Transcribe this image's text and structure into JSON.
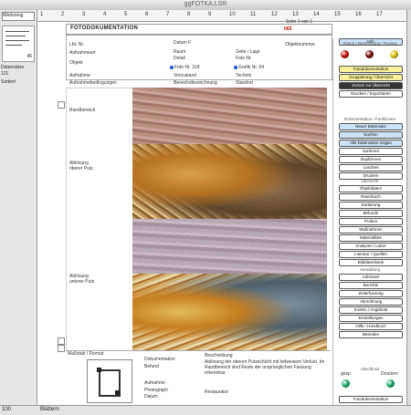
{
  "window": {
    "title": "ggFOTKA.LSR"
  },
  "ruler": {
    "ticks": [
      "1",
      "2",
      "3",
      "4",
      "5",
      "6",
      "7",
      "8",
      "9",
      "10",
      "11",
      "12",
      "13",
      "14",
      "15",
      "16",
      "17"
    ]
  },
  "left_panel": {
    "layout_select": "Werkzeug",
    "zoom_badge": "46",
    "records_label": "Datensätze",
    "records_value": "121",
    "sort_label": "Sortiert"
  },
  "header": {
    "title": "FOTODOKUMENTATION",
    "top_right": "Seite 1 von 1",
    "number": "003"
  },
  "fields": {
    "lfd_nr": "Lfd. Nr.",
    "datum": "Datum F",
    "objektnummer": "Objektnummer",
    "aufnahmeart": "Aufnahmeart",
    "raum": "Raum",
    "seite": "Seite / Lage",
    "detail": "Detail",
    "foto_nr": "Foto Nr.",
    "objekt": "Objekt",
    "radio1": "Foto Nr. 318",
    "radio2": "Grafik Nr. 04",
    "bild1": "Aufnahme",
    "bild2": "Vorzustand",
    "bild3": "Technik",
    "hint1": "Aufnahmebedingungen",
    "hint2": "Bereichsbezeichnung",
    "hint3": "Standort"
  },
  "captions": {
    "c1": "Randbereich",
    "c2": "Ablösung\noberer Putz",
    "c3": "Ablösung\nunterer Putz"
  },
  "footer": {
    "tools": "Maßstab / Format",
    "col1": "Dokumentation",
    "col2": "Befund",
    "col3": "Beschreibung",
    "text": "Ablösung der oberen Putzschicht mit teilweisem Verlust. Im Randbereich sind Reste der ursprünglichen Fassung erkennbar.",
    "note1": "Aufnahme",
    "note2": "Photograph",
    "note3": "Datum",
    "note4": "Restaurator"
  },
  "right_panel": {
    "tab": "Info",
    "signal_label": "Status / Bearbeitung / Review",
    "signals": [
      "#c40000",
      "#7a0000",
      "#d9c100"
    ],
    "buttons_top": [
      {
        "label": "Fotodokumentation",
        "style": "yel"
      },
      {
        "label": "Gruppierung / Übersicht",
        "style": "yel"
      },
      {
        "label": "Zurück zur Übersicht",
        "style": "dark"
      },
      {
        "label": "Drucken / Exportieren",
        "style": ""
      }
    ],
    "sec1": "Dokumentation / Funktionen",
    "buttons_mid": [
      {
        "label": "Neuer Datensatz",
        "style": "blu"
      },
      {
        "label": "Suchen",
        "style": "blu"
      },
      {
        "label": "Alle Datensätze zeigen",
        "style": "blu"
      },
      {
        "label": "Sortieren",
        "style": ""
      },
      {
        "label": "Duplizieren",
        "style": ""
      },
      {
        "label": "Löschen",
        "style": ""
      },
      {
        "label": "Drucken",
        "style": ""
      }
    ],
    "sec2": "Übersicht",
    "buttons_low": [
      {
        "label": "Objektdaten",
        "style": ""
      },
      {
        "label": "Raumbuch",
        "style": ""
      },
      {
        "label": "Kartierung",
        "style": ""
      },
      {
        "label": "Befunde",
        "style": ""
      },
      {
        "label": "Proben",
        "style": ""
      },
      {
        "label": "Maßnahmen",
        "style": ""
      },
      {
        "label": "Materialliste",
        "style": ""
      },
      {
        "label": "Analysen / Labor",
        "style": ""
      },
      {
        "label": "Literatur / Quellen",
        "style": ""
      },
      {
        "label": "Bilddatenbank",
        "style": ""
      }
    ],
    "sec3": "Verwaltung",
    "buttons_bottom": [
      {
        "label": "Adressen",
        "style": ""
      },
      {
        "label": "Berichte",
        "style": ""
      },
      {
        "label": "Zeiterfassung",
        "style": ""
      },
      {
        "label": "Abrechnung",
        "style": ""
      },
      {
        "label": "Kosten / Angebote",
        "style": ""
      },
      {
        "label": "Einstellungen",
        "style": ""
      },
      {
        "label": "Hilfe / Handbuch",
        "style": ""
      },
      {
        "label": "Beenden",
        "style": ""
      }
    ],
    "sec4": "Abschluss",
    "end_left": "gesp.",
    "end_right": "Drucken",
    "end_colors": [
      "#19a86a",
      "#19a86a"
    ],
    "end_button": "Fotodokumentation"
  },
  "status": {
    "zoom": "100",
    "mode": "Blättern"
  }
}
